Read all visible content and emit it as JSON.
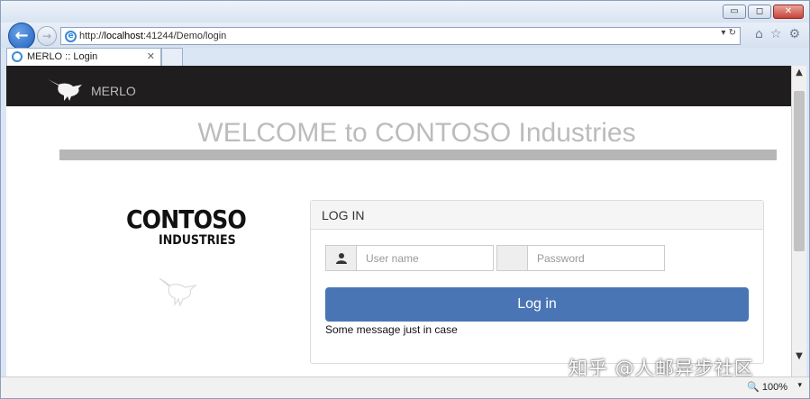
{
  "browser": {
    "address": {
      "prefix": "http://",
      "host": "localhost",
      "path": ":41244/Demo/login"
    },
    "tab": {
      "title": "MERLO :: Login",
      "close": "✕"
    },
    "controls": {
      "back": "←",
      "forward": "→",
      "refresh": "↻",
      "dropdown": "▾",
      "home": "⌂",
      "favorites": "☆",
      "settings": "⚙"
    },
    "window": {
      "minimize": "▭",
      "maximize": "◻",
      "close": "✕"
    },
    "zoom": "100%"
  },
  "site": {
    "brand": "MERLO",
    "welcome": "WELCOME to CONTOSO Industries",
    "logo": {
      "line1": "CONTOSO",
      "line2": "INDUSTRIES"
    },
    "login": {
      "heading": "LOG IN",
      "username_placeholder": "User name",
      "password_placeholder": "Password",
      "button": "Log in",
      "message": "Some message just in case"
    }
  },
  "watermark": "知乎 @人邮异步社区",
  "colors": {
    "navbar": "#1f1d1e",
    "primary_button": "#4a75b5",
    "welcome_text": "#bcbcbc"
  }
}
